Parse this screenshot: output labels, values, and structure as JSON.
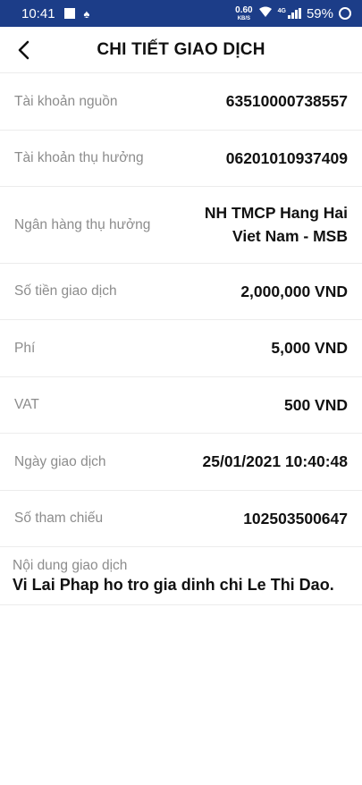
{
  "status": {
    "time": "10:41",
    "speed_value": "0.60",
    "speed_unit": "KB/S",
    "network": "4G",
    "battery": "59%"
  },
  "header": {
    "title": "CHI TIẾT GIAO DỊCH"
  },
  "rows": [
    {
      "label": "Tài khoản nguồn",
      "value": "63510000738557"
    },
    {
      "label": "Tài khoản thụ hưởng",
      "value": "06201010937409"
    },
    {
      "label": "Ngân hàng thụ hưởng",
      "value_line1": "NH TMCP Hang Hai",
      "value_line2": "Viet Nam - MSB"
    },
    {
      "label": "Số tiền giao dịch",
      "value": "2,000,000 VND"
    },
    {
      "label": "Phí",
      "value": "5,000 VND"
    },
    {
      "label": "VAT",
      "value": "500 VND"
    },
    {
      "label": "Ngày giao dịch",
      "value": "25/01/2021 10:40:48"
    },
    {
      "label": "Số tham chiếu",
      "value": "102503500647"
    }
  ],
  "description": {
    "label": "Nội dung giao dịch",
    "value": "Vi Lai Phap ho tro gia dinh chi Le Thi Dao."
  }
}
